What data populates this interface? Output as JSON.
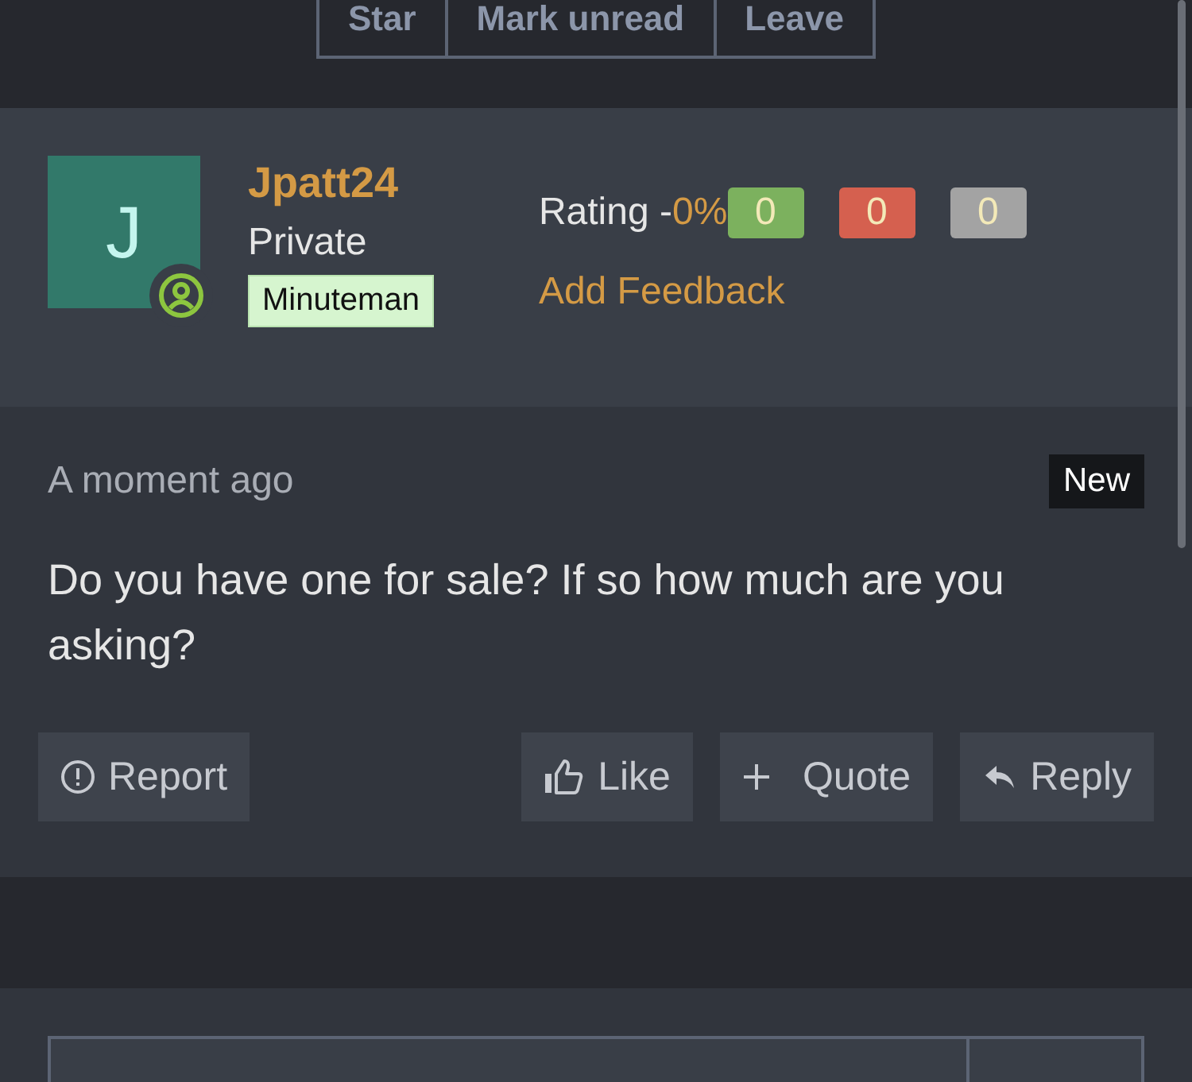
{
  "thread_actions": [
    "Star",
    "Mark unread",
    "Leave"
  ],
  "author": {
    "avatar_letter": "J",
    "name": "Jpatt24",
    "rank": "Private",
    "badge": "Minuteman"
  },
  "rating": {
    "label": "Rating -",
    "percent": "0%",
    "counters": [
      {
        "value": "0",
        "color": "#7cb15e"
      },
      {
        "value": "0",
        "color": "#d5604f"
      },
      {
        "value": "0",
        "color": "#a3a3a3"
      }
    ],
    "feedback_link": "Add Feedback"
  },
  "post": {
    "time": "A moment ago",
    "tag": "New",
    "body": "Do you have one for sale? If so how much are you asking?"
  },
  "actions": [
    {
      "kind": "report",
      "label": "Report"
    },
    {
      "kind": "like",
      "label": "Like"
    },
    {
      "kind": "quote",
      "label": "Quote"
    },
    {
      "kind": "reply",
      "label": "Reply"
    }
  ]
}
